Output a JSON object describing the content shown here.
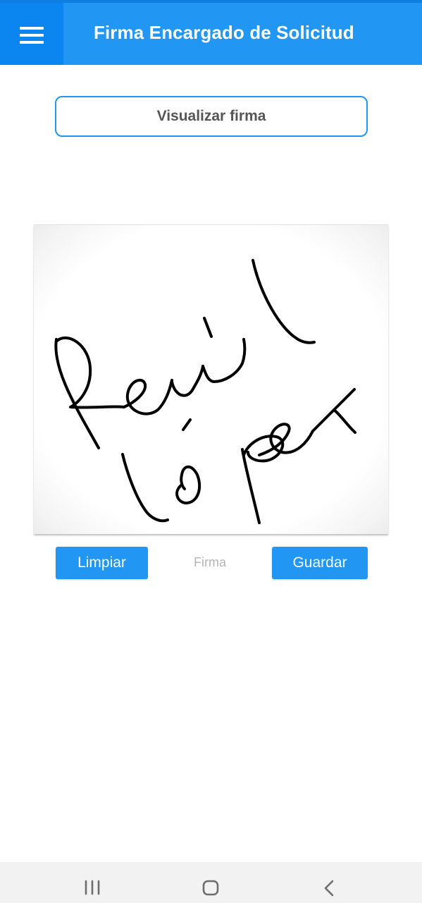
{
  "app_bar": {
    "title": "Firma Encargado de Solicitud",
    "menu_icon": "hamburger-menu-icon",
    "color": "#2196f3"
  },
  "view_signature_button": {
    "label": "Visualizar firma"
  },
  "signature_pad": {
    "ink_color": "#000000",
    "has_signature": true
  },
  "actions": {
    "clear_label": "Limpiar",
    "pad_caption": "Firma",
    "save_label": "Guardar"
  },
  "system_nav": {
    "recents_icon": "recents-icon",
    "home_icon": "home-icon",
    "back_icon": "back-icon"
  }
}
